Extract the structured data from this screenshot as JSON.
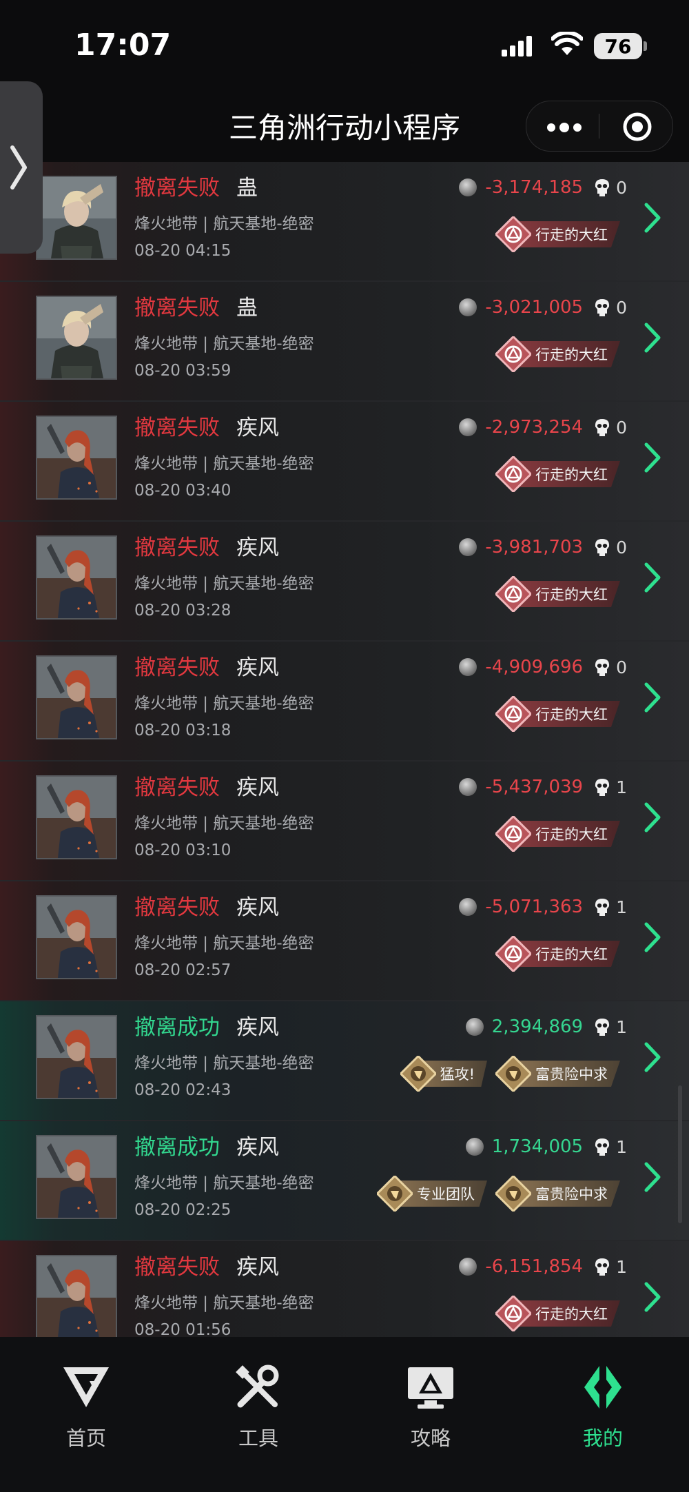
{
  "status_bar": {
    "time": "17:07",
    "battery": "76"
  },
  "nav": {
    "title": "三角洲行动小程序"
  },
  "records": [
    {
      "result": "撤离失败",
      "outcome": "fail",
      "hero": "蛊",
      "hero_style": "gu",
      "map": "烽火地带 | 航天基地-绝密",
      "time": "08-20 04:15",
      "value": "-3,174,185",
      "kills": "0",
      "badges": [
        {
          "label": "行走的大红",
          "style": "red"
        }
      ]
    },
    {
      "result": "撤离失败",
      "outcome": "fail",
      "hero": "蛊",
      "hero_style": "gu",
      "map": "烽火地带 | 航天基地-绝密",
      "time": "08-20 03:59",
      "value": "-3,021,005",
      "kills": "0",
      "badges": [
        {
          "label": "行走的大红",
          "style": "red"
        }
      ]
    },
    {
      "result": "撤离失败",
      "outcome": "fail",
      "hero": "疾风",
      "hero_style": "jifeng",
      "map": "烽火地带 | 航天基地-绝密",
      "time": "08-20 03:40",
      "value": "-2,973,254",
      "kills": "0",
      "badges": [
        {
          "label": "行走的大红",
          "style": "red"
        }
      ]
    },
    {
      "result": "撤离失败",
      "outcome": "fail",
      "hero": "疾风",
      "hero_style": "jifeng",
      "map": "烽火地带 | 航天基地-绝密",
      "time": "08-20 03:28",
      "value": "-3,981,703",
      "kills": "0",
      "badges": [
        {
          "label": "行走的大红",
          "style": "red"
        }
      ]
    },
    {
      "result": "撤离失败",
      "outcome": "fail",
      "hero": "疾风",
      "hero_style": "jifeng",
      "map": "烽火地带 | 航天基地-绝密",
      "time": "08-20 03:18",
      "value": "-4,909,696",
      "kills": "0",
      "badges": [
        {
          "label": "行走的大红",
          "style": "red"
        }
      ]
    },
    {
      "result": "撤离失败",
      "outcome": "fail",
      "hero": "疾风",
      "hero_style": "jifeng",
      "map": "烽火地带 | 航天基地-绝密",
      "time": "08-20 03:10",
      "value": "-5,437,039",
      "kills": "1",
      "badges": [
        {
          "label": "行走的大红",
          "style": "red"
        }
      ]
    },
    {
      "result": "撤离失败",
      "outcome": "fail",
      "hero": "疾风",
      "hero_style": "jifeng",
      "map": "烽火地带 | 航天基地-绝密",
      "time": "08-20 02:57",
      "value": "-5,071,363",
      "kills": "1",
      "badges": [
        {
          "label": "行走的大红",
          "style": "red"
        }
      ]
    },
    {
      "result": "撤离成功",
      "outcome": "ok",
      "hero": "疾风",
      "hero_style": "jifeng",
      "map": "烽火地带 | 航天基地-绝密",
      "time": "08-20 02:43",
      "value": "2,394,869",
      "kills": "1",
      "badges": [
        {
          "label": "猛攻!",
          "style": "gold"
        },
        {
          "label": "富贵险中求",
          "style": "gold"
        }
      ]
    },
    {
      "result": "撤离成功",
      "outcome": "ok",
      "hero": "疾风",
      "hero_style": "jifeng",
      "map": "烽火地带 | 航天基地-绝密",
      "time": "08-20 02:25",
      "value": "1,734,005",
      "kills": "1",
      "badges": [
        {
          "label": "专业团队",
          "style": "gold"
        },
        {
          "label": "富贵险中求",
          "style": "gold"
        }
      ]
    },
    {
      "result": "撤离失败",
      "outcome": "fail",
      "hero": "疾风",
      "hero_style": "jifeng",
      "map": "烽火地带 | 航天基地-绝密",
      "time": "08-20 01:56",
      "value": "-6,151,854",
      "kills": "1",
      "badges": [
        {
          "label": "行走的大红",
          "style": "red"
        }
      ]
    }
  ],
  "tabs": [
    {
      "label": "首页",
      "icon": "delta-logo-icon",
      "active": false
    },
    {
      "label": "工具",
      "icon": "tools-icon",
      "active": false
    },
    {
      "label": "攻略",
      "icon": "guide-monitor-icon",
      "active": false
    },
    {
      "label": "我的",
      "icon": "profile-logo-icon",
      "active": true
    }
  ],
  "colors": {
    "fail": "#e2383f",
    "success": "#32d68e",
    "active_tab": "#2ee08f"
  }
}
